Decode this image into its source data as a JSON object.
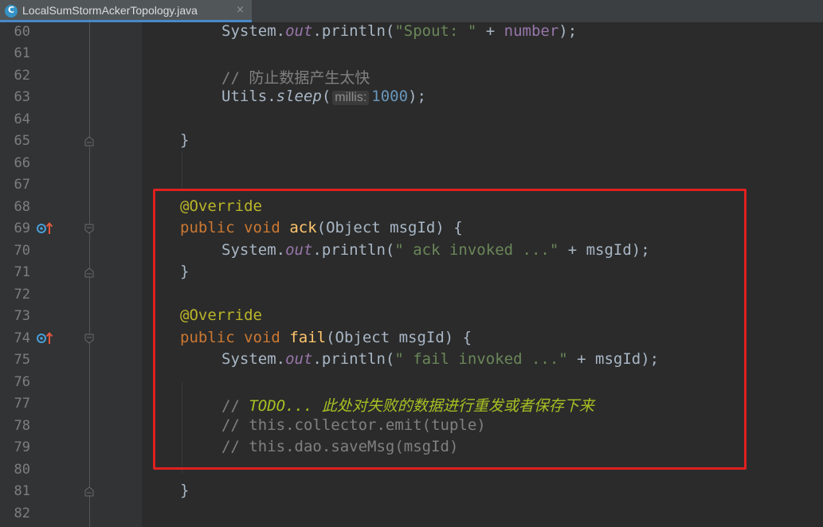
{
  "tab": {
    "icon": "java-class-icon",
    "filename": "LocalSumStormAckerTopology.java",
    "close_label": "×"
  },
  "line_numbers": [
    "60",
    "61",
    "62",
    "63",
    "64",
    "65",
    "66",
    "67",
    "68",
    "69",
    "70",
    "71",
    "72",
    "73",
    "74",
    "75",
    "76",
    "77",
    "78",
    "79",
    "80",
    "81",
    "82"
  ],
  "code": {
    "l60": {
      "a": "System.",
      "b": "out",
      "c": ".println(",
      "d": "\"Spout: \"",
      "e": " + ",
      "f": "number",
      "g": ");"
    },
    "l62": {
      "a": "// 防止数据产生太快"
    },
    "l63": {
      "a": "Utils.",
      "b": "sleep",
      "c": "(",
      "hint": "millis:",
      "d": "1000",
      "e": ");"
    },
    "l65": {
      "a": "}"
    },
    "l68": {
      "a": "@Override"
    },
    "l69": {
      "a": "public",
      "b": " ",
      "c": "void",
      "d": " ",
      "e": "ack",
      "f": "(Object msgId) {"
    },
    "l70": {
      "a": "System.",
      "b": "out",
      "c": ".println(",
      "d": "\" ack invoked ...\"",
      "e": " + msgId);"
    },
    "l71": {
      "a": "}"
    },
    "l73": {
      "a": "@Override"
    },
    "l74": {
      "a": "public",
      "b": " ",
      "c": "void",
      "d": " ",
      "e": "fail",
      "f": "(Object msgId) {"
    },
    "l75": {
      "a": "System.",
      "b": "out",
      "c": ".println(",
      "d": "\" fail invoked ...\"",
      "e": " + msgId);"
    },
    "l77": {
      "a": "// ",
      "b": "TODO... 此处对失败的数据进行重发或者保存下来"
    },
    "l78": {
      "a": "// this.collector.emit(tuple)"
    },
    "l79": {
      "a": "// this.dao.saveMsg(msgId)"
    },
    "l81": {
      "a": "}"
    }
  },
  "gutter_icons": {
    "override_marker": "override-method-icon",
    "fold_marker": "fold-icon"
  },
  "colors": {
    "background": "#2b2b2b",
    "gutter": "#313335",
    "highlight_box": "#e02020",
    "keyword": "#cc7832",
    "annotation": "#bbb529",
    "string": "#6a8759",
    "method": "#ffc66d",
    "todo": "#a8c023"
  }
}
